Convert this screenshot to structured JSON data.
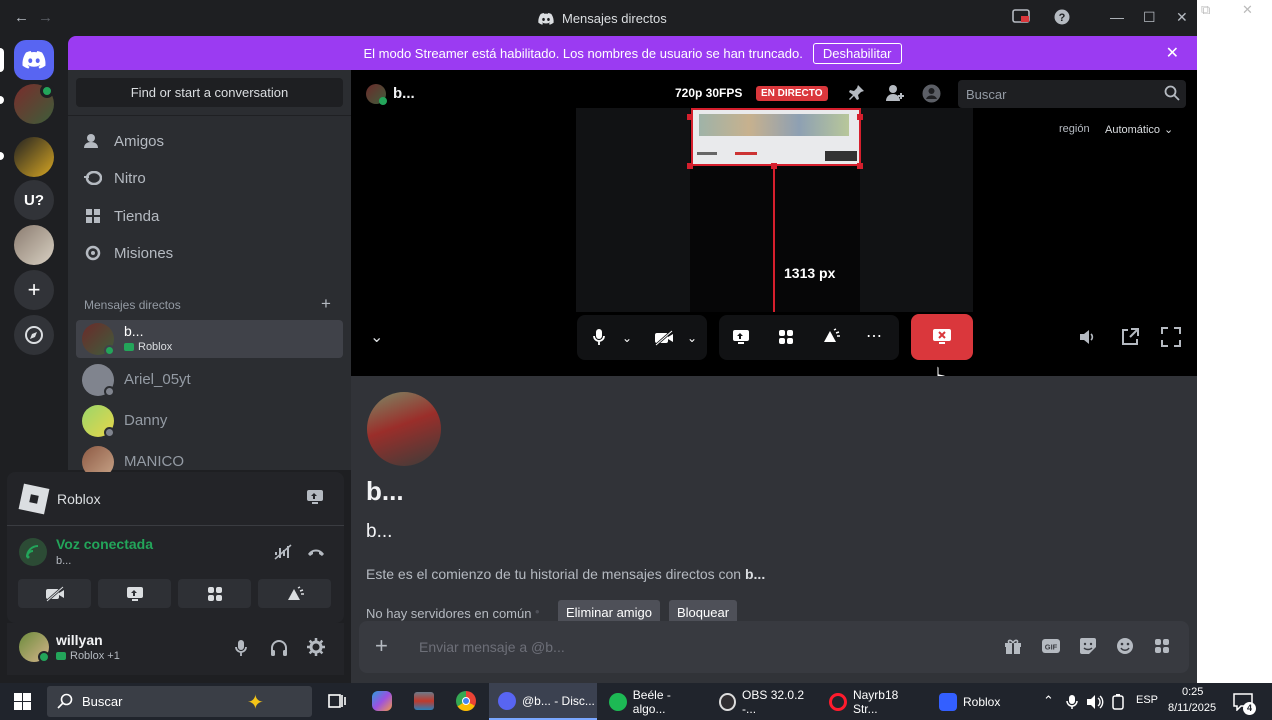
{
  "window": {
    "title": "Mensajes directos"
  },
  "banner": {
    "text": "El modo Streamer está habilitado. Los nombres de usuario se han truncado.",
    "button": "Deshabilitar"
  },
  "rail": {
    "unknown_server_label": "U?"
  },
  "sidebar": {
    "search_placeholder": "Find or start a conversation",
    "nav": [
      "Amigos",
      "Nitro",
      "Tienda",
      "Misiones"
    ],
    "dm_header": "Mensajes directos",
    "dms": [
      {
        "name": "b...",
        "activity": "Roblox"
      },
      {
        "name": "Ariel_05yt"
      },
      {
        "name": "Danny"
      },
      {
        "name": "MANICO"
      }
    ]
  },
  "voice_panel": {
    "activity": "Roblox",
    "status": "Voz conectada",
    "channel": "b..."
  },
  "user": {
    "name": "willyan",
    "activity": "Roblox +1"
  },
  "channel": {
    "name": "b...",
    "quality": "720p 30FPS",
    "live_badge": "EN DIRECTO",
    "search_placeholder": "Buscar",
    "region_label": "región",
    "region_value": "Automático",
    "measure_label": "1313 px"
  },
  "chat": {
    "profile_name": "b...",
    "profile_username": "b...",
    "intro_prefix": "Este es el comienzo de tu historial de mensajes directos con ",
    "intro_name": "b...",
    "intro_suffix": "...",
    "no_servers": "No hay servidores en común",
    "remove_friend": "Eliminar amigo",
    "block": "Bloquear",
    "composer_placeholder": "Enviar mensaje a @b..."
  },
  "taskbar": {
    "search": "Buscar",
    "apps": [
      "@b... - Disc...",
      "Beéle - algo...",
      "OBS 32.0.2 -...",
      "Nayrb18 Str...",
      "Roblox"
    ],
    "lang": "ESP",
    "time": "0:25",
    "date": "8/11/2025",
    "notifications": "4"
  },
  "colors": {
    "accent_purple": "#9b3bf2",
    "live_red": "#da373c",
    "online_green": "#23a55a",
    "blurple": "#5865f2"
  }
}
